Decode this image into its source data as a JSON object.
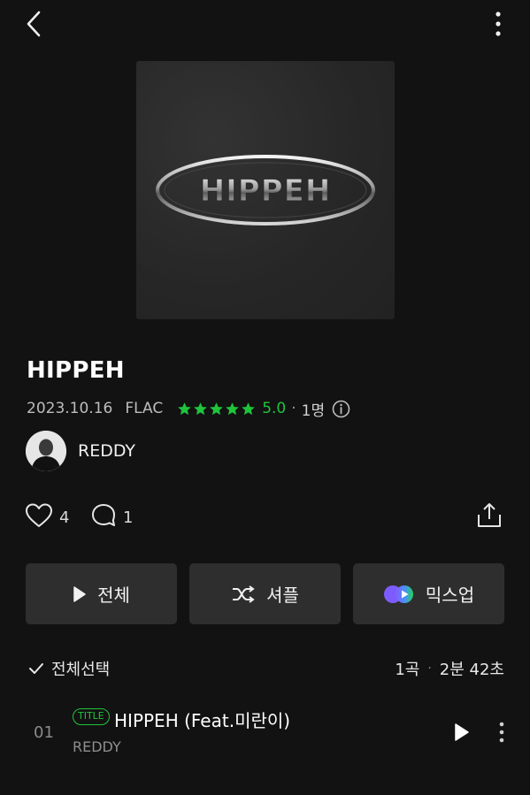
{
  "header": {
    "back_icon": "chevron-left-icon",
    "more_icon": "vertical-dots-icon"
  },
  "album": {
    "cover_text": "HIPPEH",
    "title": "HIPPEH",
    "date": "2023.10.16",
    "format": "FLAC",
    "stars": 5,
    "rating": "5.0",
    "dot": "·",
    "rating_count": "1명",
    "star_color": "#1ec53c"
  },
  "artist": {
    "name": "REDDY"
  },
  "actions": {
    "likes": "4",
    "comments": "1"
  },
  "buttons": {
    "play_all": "전체",
    "shuffle": "셔플",
    "mixup": "믹스업"
  },
  "list_header": {
    "select_all": "전체선택",
    "track_count": "1곡",
    "separator": "·",
    "duration": "2분 42초"
  },
  "tracks": [
    {
      "number": "01",
      "badge": "TITLE",
      "title": "HIPPEH (Feat.미란이)",
      "artist": "REDDY"
    }
  ],
  "colors": {
    "background": "#121212",
    "accent": "#1ec53c",
    "button_bg": "#2e2e2e"
  }
}
